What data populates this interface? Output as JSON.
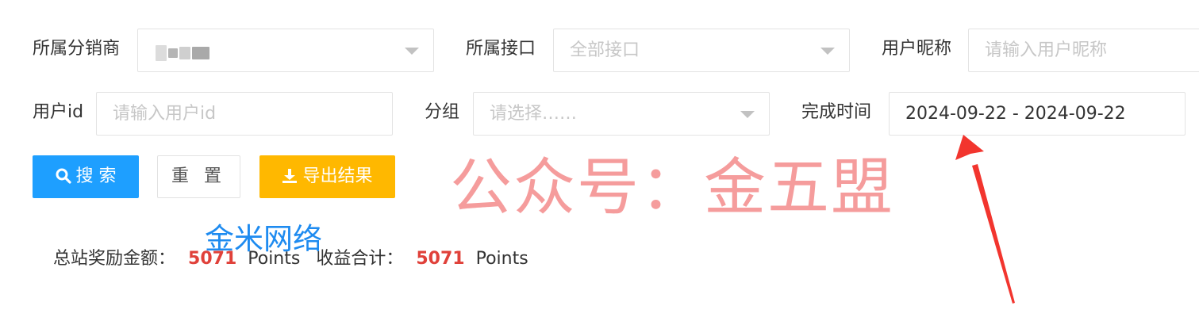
{
  "filters": {
    "distributor": {
      "label": "所属分销商",
      "value": ""
    },
    "interface": {
      "label": "所属接口",
      "placeholder": "全部接口"
    },
    "nickname": {
      "label": "用户昵称",
      "placeholder": "请输入用户昵称"
    },
    "user_id": {
      "label": "用户id",
      "placeholder": "请输入用户id"
    },
    "group": {
      "label": "分组",
      "placeholder": "请选择……"
    },
    "complete_time": {
      "label": "完成时间",
      "value": "2024-09-22 - 2024-09-22"
    }
  },
  "buttons": {
    "search": "搜 索",
    "reset": "重 置",
    "export": "导出结果"
  },
  "summary": {
    "total_reward_label": "总站奖励金额：",
    "total_reward_value": "5071",
    "total_reward_unit": "Points",
    "income_label": "收益合计：",
    "income_value": "5071",
    "income_unit": "Points"
  },
  "watermarks": {
    "red": "公众号：金五盟",
    "blue": "金米网络"
  },
  "colors": {
    "search_button": "#1e9fff",
    "export_button": "#ffb800",
    "summary_number": "#e0413a",
    "annotation_arrow": "#f2352e"
  }
}
